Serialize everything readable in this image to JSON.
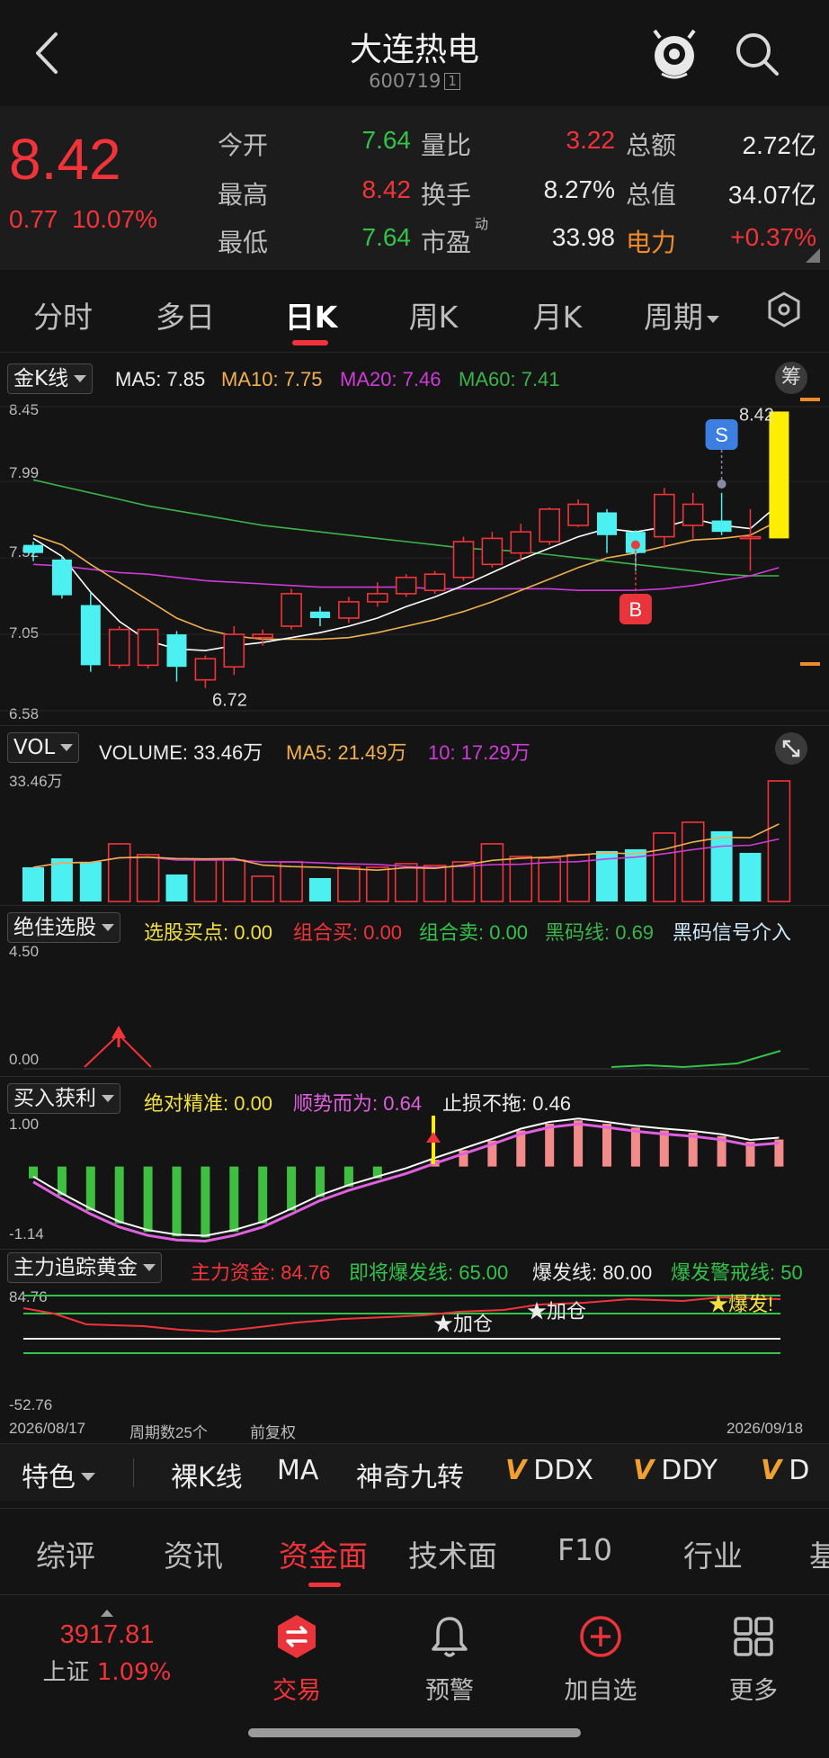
{
  "header": {
    "title": "大连热电",
    "code": "600719",
    "code_badge": "1"
  },
  "quote": {
    "price": "8.42",
    "change": "0.77",
    "change_pct": "10.07%",
    "stats": [
      {
        "label": "今开",
        "value": "7.64",
        "color": "green"
      },
      {
        "label": "量比",
        "value": "3.22",
        "color": "red"
      },
      {
        "label": "总额",
        "value": "2.72亿",
        "color": "white"
      },
      {
        "label": "最高",
        "value": "8.42",
        "color": "red"
      },
      {
        "label": "换手",
        "value": "8.27%",
        "color": "white"
      },
      {
        "label": "总值",
        "value": "34.07亿",
        "color": "white"
      },
      {
        "label": "最低",
        "value": "7.64",
        "color": "green"
      },
      {
        "label": "市盈",
        "value": "33.98",
        "color": "white"
      },
      {
        "label": "电力",
        "value": "+0.37%",
        "color": "red"
      }
    ],
    "pe_superscript": "动"
  },
  "period_tabs": [
    "分时",
    "多日",
    "日K",
    "周K",
    "月K",
    "周期"
  ],
  "active_period": "日K",
  "kline": {
    "selector": "金K线",
    "ma5": "MA5: 7.85",
    "ma10": "MA10: 7.75",
    "ma20": "MA20: 7.46",
    "ma60": "MA60: 7.41",
    "chip_label": "筹",
    "y_ticks": [
      "8.45",
      "7.99",
      "7.52",
      "7.05",
      "6.58"
    ],
    "high_label": "8.42",
    "low_label": "6.72",
    "sell_marker": "S",
    "buy_marker": "B",
    "candles": [
      [
        7.6,
        7.55,
        7.62,
        7.5
      ],
      [
        7.51,
        7.29,
        7.53,
        7.27
      ],
      [
        7.23,
        6.86,
        7.31,
        6.82
      ],
      [
        6.86,
        7.08,
        7.1,
        6.84
      ],
      [
        6.86,
        7.08,
        7.08,
        6.84
      ],
      [
        7.05,
        6.85,
        7.07,
        6.76
      ],
      [
        6.77,
        6.9,
        6.92,
        6.72
      ],
      [
        6.85,
        7.05,
        7.1,
        6.8
      ],
      [
        7.03,
        7.05,
        7.08,
        6.98
      ],
      [
        7.1,
        7.3,
        7.33,
        7.08
      ],
      [
        7.19,
        7.15,
        7.22,
        7.1
      ],
      [
        7.15,
        7.25,
        7.28,
        7.12
      ],
      [
        7.25,
        7.3,
        7.37,
        7.22
      ],
      [
        7.3,
        7.4,
        7.42,
        7.28
      ],
      [
        7.32,
        7.42,
        7.44,
        7.3
      ],
      [
        7.4,
        7.62,
        7.65,
        7.38
      ],
      [
        7.48,
        7.64,
        7.68,
        7.46
      ],
      [
        7.55,
        7.68,
        7.73,
        7.5
      ],
      [
        7.62,
        7.82,
        7.83,
        7.6
      ],
      [
        7.72,
        7.85,
        7.88,
        7.71
      ],
      [
        7.8,
        7.66,
        7.82,
        7.55
      ],
      [
        7.68,
        7.55,
        7.69,
        7.44
      ],
      [
        7.65,
        7.91,
        7.95,
        7.58
      ],
      [
        7.72,
        7.85,
        7.92,
        7.64
      ],
      [
        7.75,
        7.68,
        7.92,
        7.66
      ],
      [
        7.64,
        7.65,
        7.82,
        7.44
      ],
      [
        7.64,
        8.42,
        8.42,
        7.64
      ]
    ],
    "ma5_line": [
      7.64,
      7.53,
      7.31,
      7.13,
      7.01,
      6.96,
      6.95,
      6.98,
      7.0,
      7.03,
      7.06,
      7.1,
      7.15,
      7.22,
      7.28,
      7.35,
      7.43,
      7.51,
      7.58,
      7.65,
      7.7,
      7.68,
      7.71,
      7.76,
      7.72,
      7.7,
      7.85
    ],
    "ma10_line": [
      7.66,
      7.6,
      7.48,
      7.37,
      7.26,
      7.15,
      7.08,
      7.04,
      7.02,
      7.02,
      7.02,
      7.03,
      7.06,
      7.1,
      7.14,
      7.19,
      7.25,
      7.32,
      7.39,
      7.46,
      7.52,
      7.55,
      7.59,
      7.63,
      7.64,
      7.66,
      7.75
    ],
    "ma20_line": [
      7.48,
      7.47,
      7.45,
      7.43,
      7.42,
      7.4,
      7.38,
      7.37,
      7.36,
      7.35,
      7.34,
      7.34,
      7.34,
      7.34,
      7.33,
      7.33,
      7.33,
      7.33,
      7.33,
      7.32,
      7.32,
      7.32,
      7.33,
      7.35,
      7.38,
      7.41,
      7.46
    ],
    "ma60_line": [
      8.0,
      7.96,
      7.92,
      7.88,
      7.84,
      7.81,
      7.78,
      7.75,
      7.72,
      7.7,
      7.68,
      7.66,
      7.64,
      7.62,
      7.6,
      7.58,
      7.57,
      7.56,
      7.54,
      7.52,
      7.5,
      7.48,
      7.46,
      7.44,
      7.42,
      7.41,
      7.41
    ]
  },
  "volume": {
    "selector": "VOL",
    "volume_label": "VOLUME: 33.46万",
    "ma5_label": "MA5: 21.49万",
    "ma10_label": "10: 17.29万",
    "y_top": "33.46万",
    "bars": [
      9.5,
      12.0,
      11.0,
      16.0,
      13.0,
      7.5,
      11.5,
      11.5,
      7.0,
      11.0,
      6.5,
      9.5,
      9.5,
      10.5,
      10.0,
      11.0,
      16.0,
      12.5,
      12.0,
      13.0,
      14.0,
      14.5,
      19.0,
      22.0,
      19.5,
      13.5,
      33.46
    ],
    "up": [
      false,
      false,
      false,
      true,
      true,
      false,
      true,
      true,
      true,
      true,
      false,
      true,
      true,
      true,
      true,
      true,
      true,
      true,
      true,
      true,
      false,
      false,
      true,
      true,
      false,
      false,
      true
    ]
  },
  "jjxg": {
    "selector": "绝佳选股",
    "buy_point": "选股买点: 0.00",
    "combo_buy": "组合买: 0.00",
    "combo_sell": "组合卖: 0.00",
    "black_line": "黑码线: 0.69",
    "signal": "黑码信号介入",
    "y_top": "4.50",
    "y_bottom": "0.00"
  },
  "mrhl": {
    "selector": "买入获利",
    "accurate": "绝对精准: 0.00",
    "follow": "顺势而为: 0.64",
    "stoploss": "止损不拖: 0.46",
    "y_top": "1.00",
    "y_bottom": "-1.14",
    "bars": [
      -0.05,
      -0.35,
      -0.62,
      -0.85,
      -1.0,
      -1.08,
      -1.1,
      -1.0,
      -0.85,
      -0.62,
      -0.38,
      -0.2,
      -0.05,
      0.1,
      0.28,
      0.45,
      0.62,
      0.8,
      0.92,
      0.98,
      0.92,
      0.85,
      0.8,
      0.76,
      0.7,
      0.6,
      0.64
    ]
  },
  "zlzz": {
    "selector": "主力追踪黄金",
    "main_funds": "主力资金: 84.76",
    "about_to_burst": "即将爆发线: 65.00",
    "burst": "爆发线: 80.00",
    "burst_alert": "爆发警戒线: 50",
    "y_top": "84.76",
    "y_bottom": "-52.76",
    "tag1": "★加仓",
    "tag2": "★加仓",
    "tag3": "★爆发!"
  },
  "footer_axis": {
    "start_date": "2026/08/17",
    "period_count": "周期数25个",
    "adjust": "前复权",
    "end_date": "2026/09/18"
  },
  "feature_bar": [
    "特色",
    "裸K线",
    "MA",
    "神奇九转",
    "DDX",
    "DDY",
    "D"
  ],
  "info_tabs": [
    "综评",
    "资讯",
    "资金面",
    "技术面",
    "F10",
    "行业",
    "基"
  ],
  "active_info_tab": "资金面",
  "index": {
    "value": "3917.81",
    "name": "上证",
    "pct": "1.09%"
  },
  "bottom_nav": [
    "交易",
    "预警",
    "加自选",
    "更多"
  ],
  "colors": {
    "up": "#f2343a",
    "down": "#4df0f0",
    "ma5": "#ffffff",
    "ma10": "#f0b050",
    "ma20": "#d03ad8",
    "ma60": "#3bb34a",
    "yellow_bar": "#ffee00"
  }
}
